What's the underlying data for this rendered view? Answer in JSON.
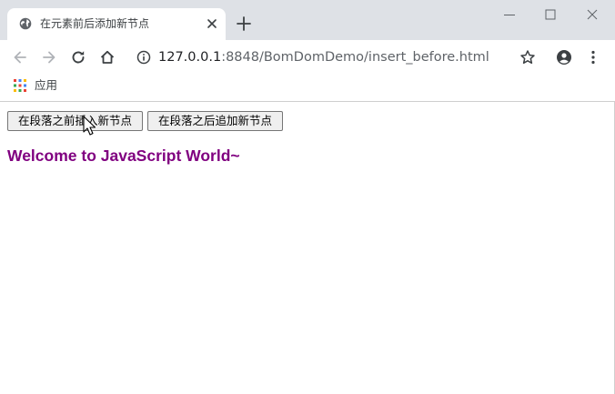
{
  "browser": {
    "tab_title": "在元素前后添加新节点",
    "url_host": "127.0.0.1",
    "url_rest": ":8848/BomDomDemo/insert_before.html",
    "bookmarks_apps_label": "应用"
  },
  "page": {
    "buttons": {
      "insert_before_label": "在段落之前插入新节点",
      "append_after_label": "在段落之后追加新节点"
    },
    "heading": "Welcome to JavaScript World~",
    "heading_color": "#800080"
  }
}
